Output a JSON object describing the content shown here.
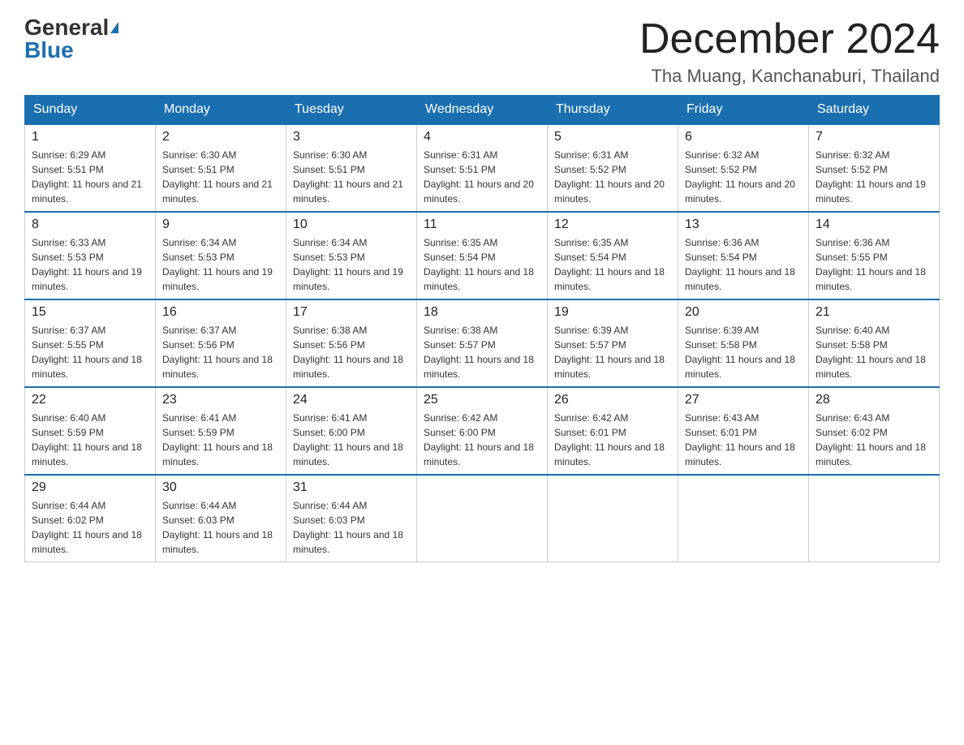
{
  "header": {
    "logo_general": "General",
    "logo_blue": "Blue",
    "month_title": "December 2024",
    "subtitle": "Tha Muang, Kanchanaburi, Thailand"
  },
  "days_of_week": [
    "Sunday",
    "Monday",
    "Tuesday",
    "Wednesday",
    "Thursday",
    "Friday",
    "Saturday"
  ],
  "weeks": [
    [
      {
        "day": "1",
        "sunrise": "6:29 AM",
        "sunset": "5:51 PM",
        "daylight": "11 hours and 21 minutes."
      },
      {
        "day": "2",
        "sunrise": "6:30 AM",
        "sunset": "5:51 PM",
        "daylight": "11 hours and 21 minutes."
      },
      {
        "day": "3",
        "sunrise": "6:30 AM",
        "sunset": "5:51 PM",
        "daylight": "11 hours and 21 minutes."
      },
      {
        "day": "4",
        "sunrise": "6:31 AM",
        "sunset": "5:51 PM",
        "daylight": "11 hours and 20 minutes."
      },
      {
        "day": "5",
        "sunrise": "6:31 AM",
        "sunset": "5:52 PM",
        "daylight": "11 hours and 20 minutes."
      },
      {
        "day": "6",
        "sunrise": "6:32 AM",
        "sunset": "5:52 PM",
        "daylight": "11 hours and 20 minutes."
      },
      {
        "day": "7",
        "sunrise": "6:32 AM",
        "sunset": "5:52 PM",
        "daylight": "11 hours and 19 minutes."
      }
    ],
    [
      {
        "day": "8",
        "sunrise": "6:33 AM",
        "sunset": "5:53 PM",
        "daylight": "11 hours and 19 minutes."
      },
      {
        "day": "9",
        "sunrise": "6:34 AM",
        "sunset": "5:53 PM",
        "daylight": "11 hours and 19 minutes."
      },
      {
        "day": "10",
        "sunrise": "6:34 AM",
        "sunset": "5:53 PM",
        "daylight": "11 hours and 19 minutes."
      },
      {
        "day": "11",
        "sunrise": "6:35 AM",
        "sunset": "5:54 PM",
        "daylight": "11 hours and 18 minutes."
      },
      {
        "day": "12",
        "sunrise": "6:35 AM",
        "sunset": "5:54 PM",
        "daylight": "11 hours and 18 minutes."
      },
      {
        "day": "13",
        "sunrise": "6:36 AM",
        "sunset": "5:54 PM",
        "daylight": "11 hours and 18 minutes."
      },
      {
        "day": "14",
        "sunrise": "6:36 AM",
        "sunset": "5:55 PM",
        "daylight": "11 hours and 18 minutes."
      }
    ],
    [
      {
        "day": "15",
        "sunrise": "6:37 AM",
        "sunset": "5:55 PM",
        "daylight": "11 hours and 18 minutes."
      },
      {
        "day": "16",
        "sunrise": "6:37 AM",
        "sunset": "5:56 PM",
        "daylight": "11 hours and 18 minutes."
      },
      {
        "day": "17",
        "sunrise": "6:38 AM",
        "sunset": "5:56 PM",
        "daylight": "11 hours and 18 minutes."
      },
      {
        "day": "18",
        "sunrise": "6:38 AM",
        "sunset": "5:57 PM",
        "daylight": "11 hours and 18 minutes."
      },
      {
        "day": "19",
        "sunrise": "6:39 AM",
        "sunset": "5:57 PM",
        "daylight": "11 hours and 18 minutes."
      },
      {
        "day": "20",
        "sunrise": "6:39 AM",
        "sunset": "5:58 PM",
        "daylight": "11 hours and 18 minutes."
      },
      {
        "day": "21",
        "sunrise": "6:40 AM",
        "sunset": "5:58 PM",
        "daylight": "11 hours and 18 minutes."
      }
    ],
    [
      {
        "day": "22",
        "sunrise": "6:40 AM",
        "sunset": "5:59 PM",
        "daylight": "11 hours and 18 minutes."
      },
      {
        "day": "23",
        "sunrise": "6:41 AM",
        "sunset": "5:59 PM",
        "daylight": "11 hours and 18 minutes."
      },
      {
        "day": "24",
        "sunrise": "6:41 AM",
        "sunset": "6:00 PM",
        "daylight": "11 hours and 18 minutes."
      },
      {
        "day": "25",
        "sunrise": "6:42 AM",
        "sunset": "6:00 PM",
        "daylight": "11 hours and 18 minutes."
      },
      {
        "day": "26",
        "sunrise": "6:42 AM",
        "sunset": "6:01 PM",
        "daylight": "11 hours and 18 minutes."
      },
      {
        "day": "27",
        "sunrise": "6:43 AM",
        "sunset": "6:01 PM",
        "daylight": "11 hours and 18 minutes."
      },
      {
        "day": "28",
        "sunrise": "6:43 AM",
        "sunset": "6:02 PM",
        "daylight": "11 hours and 18 minutes."
      }
    ],
    [
      {
        "day": "29",
        "sunrise": "6:44 AM",
        "sunset": "6:02 PM",
        "daylight": "11 hours and 18 minutes."
      },
      {
        "day": "30",
        "sunrise": "6:44 AM",
        "sunset": "6:03 PM",
        "daylight": "11 hours and 18 minutes."
      },
      {
        "day": "31",
        "sunrise": "6:44 AM",
        "sunset": "6:03 PM",
        "daylight": "11 hours and 18 minutes."
      },
      null,
      null,
      null,
      null
    ]
  ]
}
